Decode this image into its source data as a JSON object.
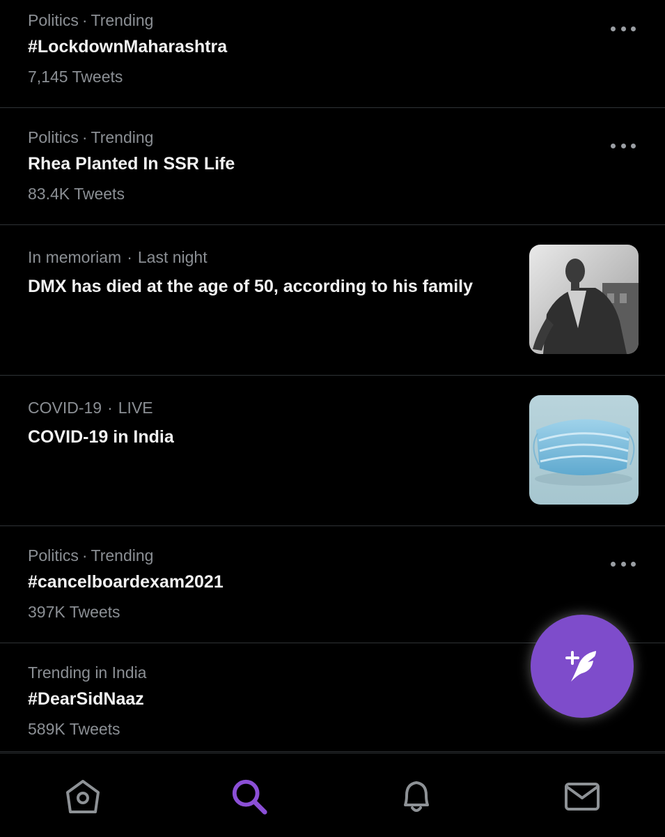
{
  "trends": [
    {
      "category": "Politics",
      "context": "Trending",
      "title": "#LockdownMaharashtra",
      "count": "7,145 Tweets",
      "more_icon": "more-horizontal-icon"
    },
    {
      "category": "Politics",
      "context": "Trending",
      "title": "Rhea Planted In SSR Life",
      "count": "83.4K Tweets",
      "more_icon": "more-horizontal-icon"
    },
    {
      "category": "In memoriam",
      "context": "Last night",
      "title": "DMX has died at the age of 50, according to his family",
      "thumbnail": "portrait-photo"
    },
    {
      "category": "COVID-19",
      "context": "LIVE",
      "title": "COVID-19 in India",
      "thumbnail": "face-mask-photo"
    },
    {
      "category": "Politics",
      "context": "Trending",
      "title": "#cancelboardexam2021",
      "count": "397K Tweets",
      "more_icon": "more-horizontal-icon"
    },
    {
      "category": "Trending in India",
      "title": "#DearSidNaaz",
      "count": "589K Tweets"
    }
  ],
  "separator": "·",
  "fab": {
    "icon": "compose-tweet-icon",
    "color": "#7e4ccb"
  },
  "nav": {
    "items": [
      {
        "icon": "home-icon",
        "active": false
      },
      {
        "icon": "search-icon",
        "active": true
      },
      {
        "icon": "bell-icon",
        "active": false
      },
      {
        "icon": "mail-icon",
        "active": false
      }
    ],
    "active_color": "#8b4fd6",
    "inactive_color": "#8e9296"
  },
  "colors": {
    "background": "#000000",
    "text_primary": "#f2f2f2",
    "text_secondary": "#8b8f94",
    "divider": "#2f3336"
  }
}
